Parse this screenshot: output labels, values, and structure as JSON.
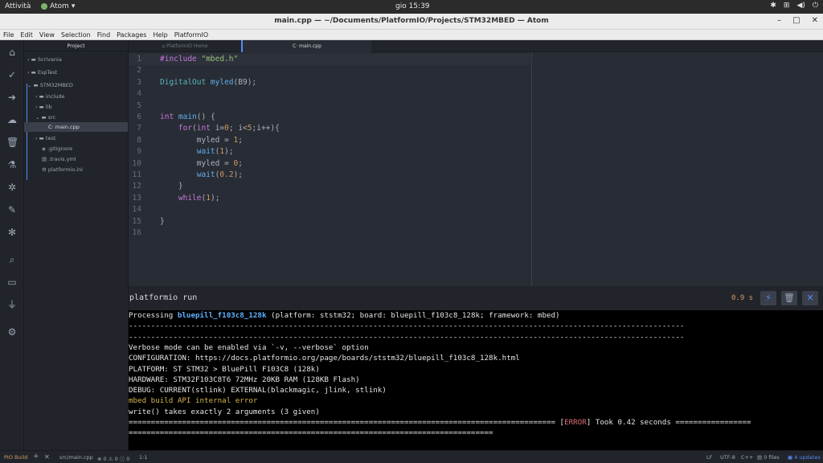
{
  "topbar": {
    "activities": "Attività",
    "app": "Atom",
    "clock": "gio 15:39"
  },
  "window": {
    "title": "main.cpp — ~/Documents/PlatformIO/Projects/STM32MBED — Atom"
  },
  "menu": [
    "File",
    "Edit",
    "View",
    "Selection",
    "Find",
    "Packages",
    "Help",
    "PlatformIO"
  ],
  "tree": {
    "header": "Project",
    "items": [
      "Scrivania",
      "EspTest",
      "STM32MBED",
      "include",
      "lib",
      "src",
      "main.cpp",
      "test",
      ".gitignore",
      ".travis.yml",
      "platformio.ini"
    ]
  },
  "tabs": [
    "PlatformIO Home",
    "main.cpp"
  ],
  "editor": {
    "line_numbers": [
      "1",
      "2",
      "3",
      "4",
      "5",
      "6",
      "7",
      "8",
      "9",
      "10",
      "11",
      "12",
      "13",
      "14",
      "15",
      "16"
    ]
  },
  "panel": {
    "command": "platformio run",
    "time": "0.9 s"
  },
  "terminal": {
    "processing_prefix": "Processing ",
    "board": "bluepill_f103c8_128k",
    "processing_suffix": " (platform: ststm32; board: bluepill_f103c8_128k; framework: mbed)",
    "dashes1": "-----------------------------------------------------------------------------------------------------------------------------",
    "dashes2": "-----------------------------------------------------------------------------------------------------------------------------",
    "verbose": "Verbose mode can be enabled via `-v, --verbose` option",
    "configuration": "CONFIGURATION: https://docs.platformio.org/page/boards/ststm32/bluepill_f103c8_128k.html",
    "platform": "PLATFORM: ST STM32 > BluePill F103C8 (128k)",
    "hardware": "HARDWARE: STM32F103C8T6 72MHz 20KB RAM (128KB Flash)",
    "debug": "DEBUG: CURRENT(stlink) EXTERNAL(blackmagic, jlink, stlink)",
    "mbed_error": "mbed build API internal error",
    "write_error": "write() takes exactly 2 arguments (3 given)",
    "eq_prefix": "================================================================================================ [",
    "error_tag": "ERROR",
    "eq_suffix": "] Took 0.42 seconds =================",
    "eq_line2": "=================================================================================="
  },
  "status": {
    "pio_build": "PIO Build",
    "file": "src/main.cpp",
    "diagnostics": "0 ⚠ 0 ⓘ 0",
    "cursor": "1:1",
    "eol": "LF",
    "encoding": "UTF-8",
    "grammar": "C++",
    "files": "0 files",
    "updates": "4 updates"
  }
}
